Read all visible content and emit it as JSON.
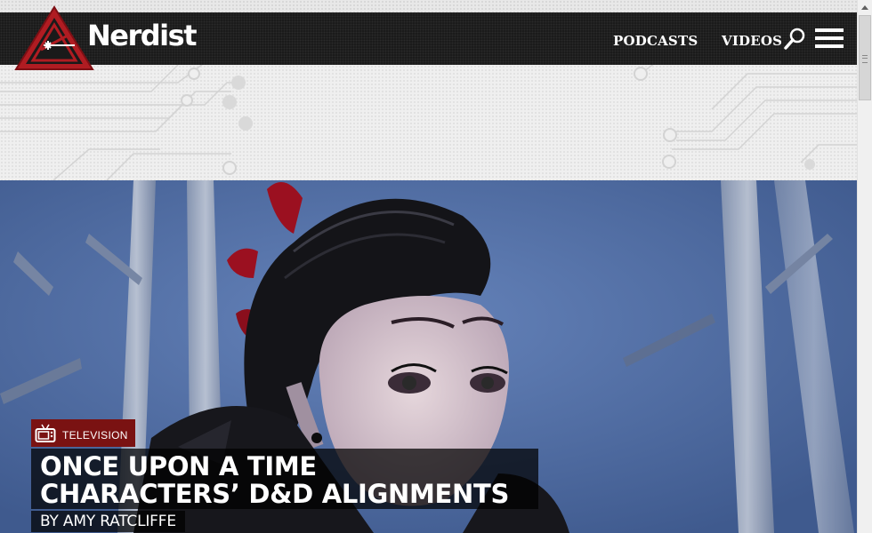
{
  "site": {
    "brand_name": "Nerdist",
    "accent_color": "#b01c22"
  },
  "nav": {
    "items": [
      {
        "label": "PODCASTS"
      },
      {
        "label": "VIDEOS"
      }
    ],
    "search_icon": "search-icon",
    "menu_icon": "hamburger-menu-icon"
  },
  "hero": {
    "category": {
      "label": "TELEVISION",
      "icon": "tv-icon",
      "color": "#7a1212"
    },
    "headline": {
      "line1": "ONCE UPON A TIME",
      "line2": "CHARACTERS’ D&D ALIGNMENTS"
    },
    "byline": "BY AMY RATCLIFFE"
  }
}
